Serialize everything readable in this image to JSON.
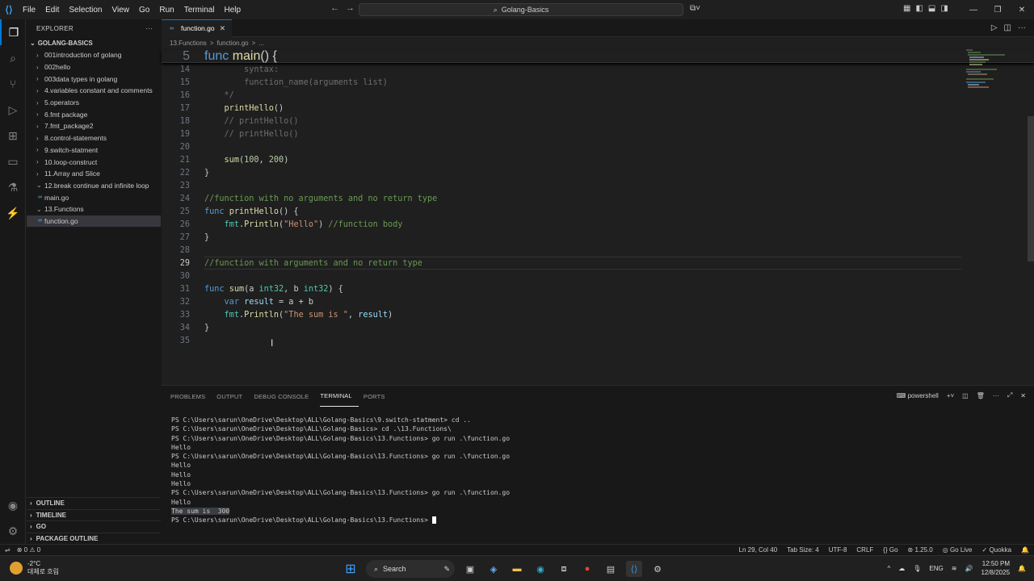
{
  "menu": [
    "File",
    "Edit",
    "Selection",
    "View",
    "Go",
    "Run",
    "Terminal",
    "Help"
  ],
  "command_center": "Golang-Basics",
  "explorer": {
    "title": "EXPLORER",
    "root": "GOLANG-BASICS",
    "items": [
      {
        "label": "001introduction of golang",
        "type": "folder",
        "depth": 1
      },
      {
        "label": "002hello",
        "type": "folder",
        "depth": 1
      },
      {
        "label": "003data types in golang",
        "type": "folder",
        "depth": 1
      },
      {
        "label": "4.variables constant and comments",
        "type": "folder",
        "depth": 1
      },
      {
        "label": "5.operators",
        "type": "folder",
        "depth": 1
      },
      {
        "label": "6.fmt package",
        "type": "folder",
        "depth": 1
      },
      {
        "label": "7.fmt_package2",
        "type": "folder",
        "depth": 1
      },
      {
        "label": "8.control-statements",
        "type": "folder",
        "depth": 1
      },
      {
        "label": "9.switch-statment",
        "type": "folder",
        "depth": 1
      },
      {
        "label": "10.loop-construct",
        "type": "folder",
        "depth": 1
      },
      {
        "label": "11.Array and Slice",
        "type": "folder",
        "depth": 1
      },
      {
        "label": "12.break continue and infinite loop",
        "type": "open-folder",
        "depth": 1
      },
      {
        "label": "main.go",
        "type": "file",
        "depth": 2
      },
      {
        "label": "13.Functions",
        "type": "open-folder",
        "depth": 1
      },
      {
        "label": "function.go",
        "type": "file",
        "depth": 2,
        "selected": true
      }
    ],
    "sections": [
      "OUTLINE",
      "TIMELINE",
      "GO",
      "PACKAGE OUTLINE"
    ]
  },
  "editor": {
    "tab": "function.go",
    "breadcrumb": [
      "13.Functions",
      ">",
      "function.go",
      ">",
      "..."
    ],
    "sticky": {
      "num": "5",
      "text": "func main() {"
    },
    "lines": [
      {
        "num": "14",
        "text": "        syntax:"
      },
      {
        "num": "15",
        "text": "        function_name(arguments list)"
      },
      {
        "num": "16",
        "text": "    */"
      },
      {
        "num": "17",
        "text": "    printHello()"
      },
      {
        "num": "18",
        "text": "    // printHello()"
      },
      {
        "num": "19",
        "text": "    // printHello()"
      },
      {
        "num": "20",
        "text": ""
      },
      {
        "num": "21",
        "text": "    sum(100, 200)"
      },
      {
        "num": "22",
        "text": "}"
      },
      {
        "num": "23",
        "text": ""
      },
      {
        "num": "24",
        "text": "//function with no arguments and no return type"
      },
      {
        "num": "25",
        "text": "func printHello() {"
      },
      {
        "num": "26",
        "text": "    fmt.Println(\"Hello\") //function body"
      },
      {
        "num": "27",
        "text": "}"
      },
      {
        "num": "28",
        "text": ""
      },
      {
        "num": "29",
        "text": "//function with arguments and no return type"
      },
      {
        "num": "30",
        "text": ""
      },
      {
        "num": "31",
        "text": "func sum(a int32, b int32) {"
      },
      {
        "num": "32",
        "text": "    var result = a + b"
      },
      {
        "num": "33",
        "text": "    fmt.Println(\"The sum is \", result)"
      },
      {
        "num": "34",
        "text": "}"
      },
      {
        "num": "35",
        "text": ""
      }
    ]
  },
  "panel": {
    "tabs": [
      "PROBLEMS",
      "OUTPUT",
      "DEBUG CONSOLE",
      "TERMINAL",
      "PORTS"
    ],
    "active_tab": "TERMINAL",
    "shell": "powershell",
    "terminal_lines": [
      "PS C:\\Users\\sarun\\OneDrive\\Desktop\\ALL\\Golang-Basics\\9.switch-statment> cd ..",
      "PS C:\\Users\\sarun\\OneDrive\\Desktop\\ALL\\Golang-Basics> cd .\\13.Functions\\",
      "PS C:\\Users\\sarun\\OneDrive\\Desktop\\ALL\\Golang-Basics\\13.Functions> go run .\\function.go",
      "Hello",
      "PS C:\\Users\\sarun\\OneDrive\\Desktop\\ALL\\Golang-Basics\\13.Functions> go run .\\function.go",
      "Hello",
      "Hello",
      "Hello",
      "PS C:\\Users\\sarun\\OneDrive\\Desktop\\ALL\\Golang-Basics\\13.Functions> go run .\\function.go",
      "Hello",
      "The sum is  300",
      "PS C:\\Users\\sarun\\OneDrive\\Desktop\\ALL\\Golang-Basics\\13.Functions> "
    ]
  },
  "status": {
    "errors": "0",
    "warnings": "0",
    "position": "Ln 29, Col 40",
    "tab_size": "Tab Size: 4",
    "encoding": "UTF-8",
    "eol": "CRLF",
    "language": "Go",
    "go_version": "1.25.0",
    "go_live": "Go Live",
    "quokka": "Quokka"
  },
  "taskbar": {
    "temperature": "-2°C",
    "weather": "대체로 흐림",
    "search": "Search",
    "lang": "ENG",
    "time": "12:50 PM",
    "date": "12/8/2025"
  }
}
